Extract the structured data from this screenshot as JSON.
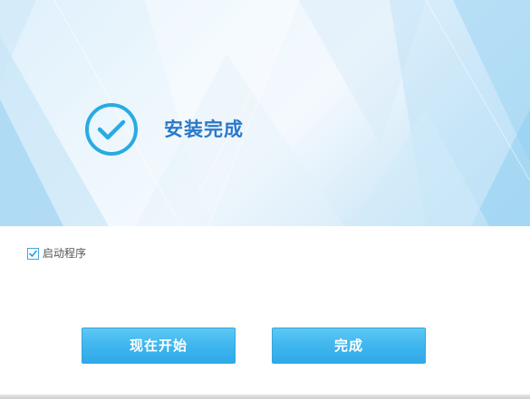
{
  "banner": {
    "title": "安装完成",
    "icon": "check-circle-icon"
  },
  "options": {
    "launch_label": "启动程序",
    "launch_checked": true
  },
  "buttons": {
    "start_label": "现在开始",
    "finish_label": "完成"
  },
  "colors": {
    "accent": "#29abe2",
    "title": "#2b79c9",
    "button": "#3fb6ee"
  }
}
